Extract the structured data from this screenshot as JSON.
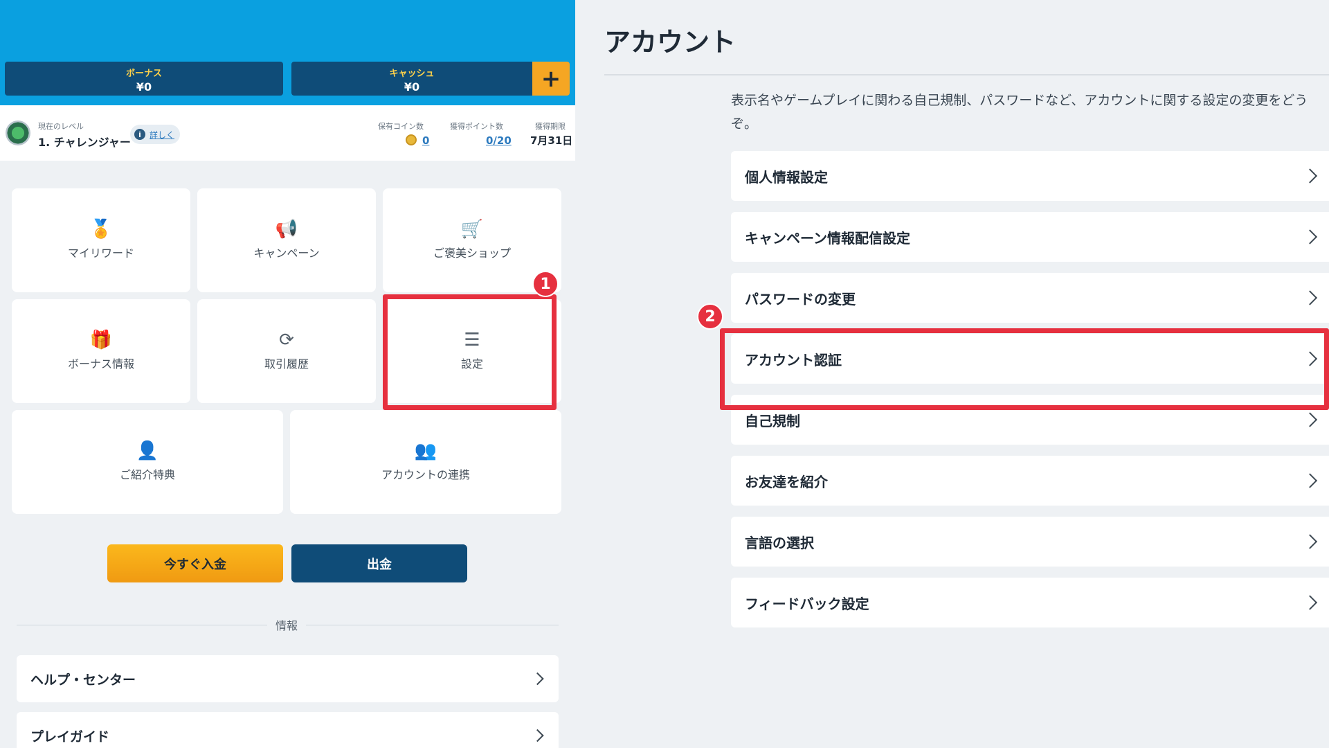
{
  "wallet": {
    "bonus": {
      "label": "ボーナス",
      "value": "¥0"
    },
    "cash": {
      "label": "キャッシュ",
      "value": "¥0"
    },
    "plus_label": "+"
  },
  "level": {
    "current_label": "現在のレベル",
    "title": "1. チャレンジャー",
    "detail_link": "詳しく",
    "coins_label": "保有コイン数",
    "coins_value": "0",
    "points_label": "獲得ポイント数",
    "points_value": "0/20",
    "deadline_label": "獲得期限",
    "deadline_value": "7月31日"
  },
  "tiles": [
    {
      "label": "マイリワード",
      "icon": "medal-icon"
    },
    {
      "label": "キャンペーン",
      "icon": "megaphone-icon"
    },
    {
      "label": "ご褒美ショップ",
      "icon": "cart-icon"
    },
    {
      "label": "ボーナス情報",
      "icon": "gift-icon"
    },
    {
      "label": "取引履歴",
      "icon": "refresh-icon"
    },
    {
      "label": "設定",
      "icon": "sliders-icon"
    },
    {
      "label": "ご紹介特典",
      "icon": "user-add-icon"
    },
    {
      "label": "アカウントの連携",
      "icon": "users-link-icon"
    }
  ],
  "actions": {
    "deposit": "今すぐ入金",
    "withdraw": "出金"
  },
  "info_section": {
    "label": "情報",
    "rows": [
      "ヘルプ・センター",
      "プレイガイド"
    ]
  },
  "badges": {
    "step1": "1",
    "step2": "2"
  },
  "account": {
    "title": "アカウント",
    "description": "表示名やゲームプレイに関わる自己規制、パスワードなど、アカウントに関する設定の変更をどうぞ。",
    "menu": [
      "個人情報設定",
      "キャンペーン情報配信設定",
      "パスワードの変更",
      "アカウント認証",
      "自己規制",
      "お友達を紹介",
      "言語の選択",
      "フィードバック設定"
    ]
  },
  "colors": {
    "header_blue": "#0aa0e0",
    "navy": "#0f4c78",
    "orange": "#f5a623",
    "highlight_red": "#e6303f"
  }
}
